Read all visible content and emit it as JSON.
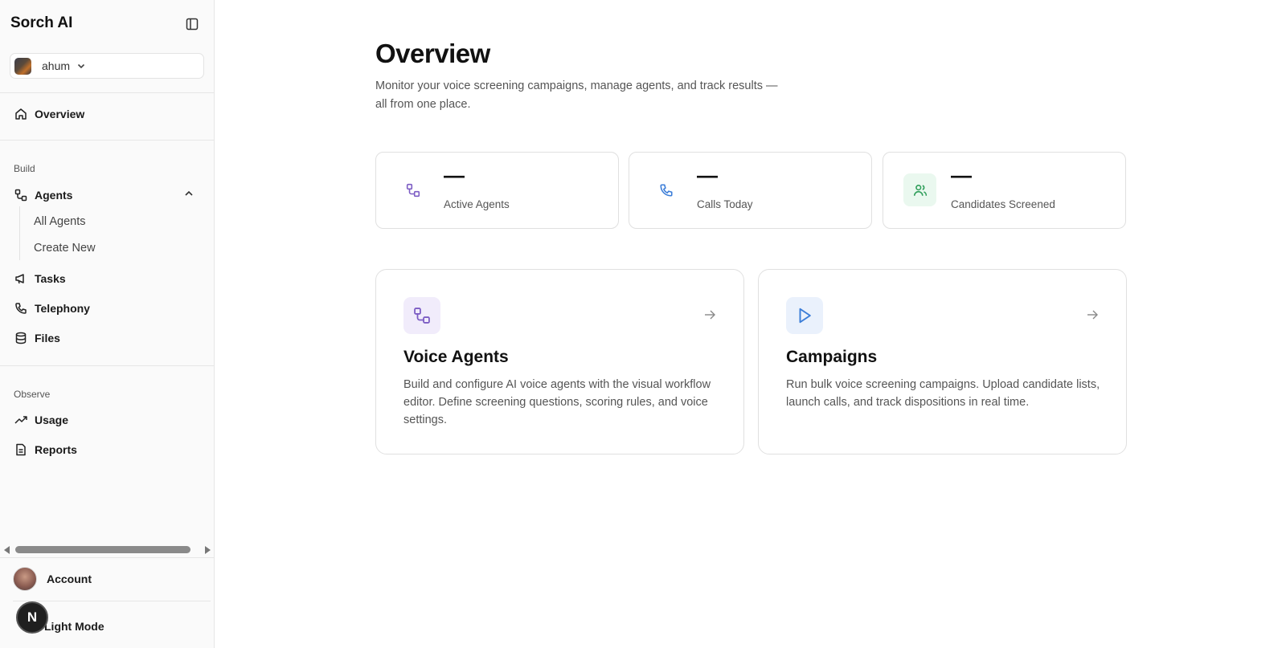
{
  "sidebar": {
    "brand": "Sorch AI",
    "workspace": {
      "name": "ahum"
    },
    "top_nav": [
      {
        "label": "Overview",
        "icon": "home-icon"
      }
    ],
    "build": {
      "label": "Build",
      "agents": {
        "label": "Agents",
        "icon": "workflow-icon",
        "expanded": true,
        "children": [
          "All Agents",
          "Create New"
        ]
      },
      "items": [
        {
          "label": "Tasks",
          "icon": "megaphone-icon"
        },
        {
          "label": "Telephony",
          "icon": "phone-icon"
        },
        {
          "label": "Files",
          "icon": "database-icon"
        }
      ]
    },
    "observe": {
      "label": "Observe",
      "items": [
        {
          "label": "Usage",
          "icon": "trending-up-icon"
        },
        {
          "label": "Reports",
          "icon": "file-text-icon"
        }
      ]
    },
    "footer": {
      "account": "Account",
      "mode": "Light Mode",
      "badge": "N"
    }
  },
  "main": {
    "title": "Overview",
    "subtitle": "Monitor your voice screening campaigns, manage agents, and track results — all from one place.",
    "stats": [
      {
        "value": "—",
        "label": "Active Agents",
        "icon": "workflow-icon",
        "color": "#7c5cc4",
        "bg": "#ffffff"
      },
      {
        "value": "—",
        "label": "Calls Today",
        "icon": "phone-icon",
        "color": "#3b7dd8",
        "bg": "#ffffff"
      },
      {
        "value": "—",
        "label": "Candidates Screened",
        "icon": "users-icon",
        "color": "#2f9e5a",
        "bg": "#eaf8ef"
      }
    ],
    "features": [
      {
        "title": "Voice Agents",
        "description": "Build and configure AI voice agents with the visual workflow editor. Define screening questions, scoring rules, and voice settings.",
        "icon": "workflow-icon",
        "color": "#7c5cc4",
        "bg": "#f1ecfb"
      },
      {
        "title": "Campaigns",
        "description": "Run bulk voice screening campaigns. Upload candidate lists, launch calls, and track dispositions in real time.",
        "icon": "play-icon",
        "color": "#3b7dd8",
        "bg": "#eaf1fc"
      }
    ]
  }
}
